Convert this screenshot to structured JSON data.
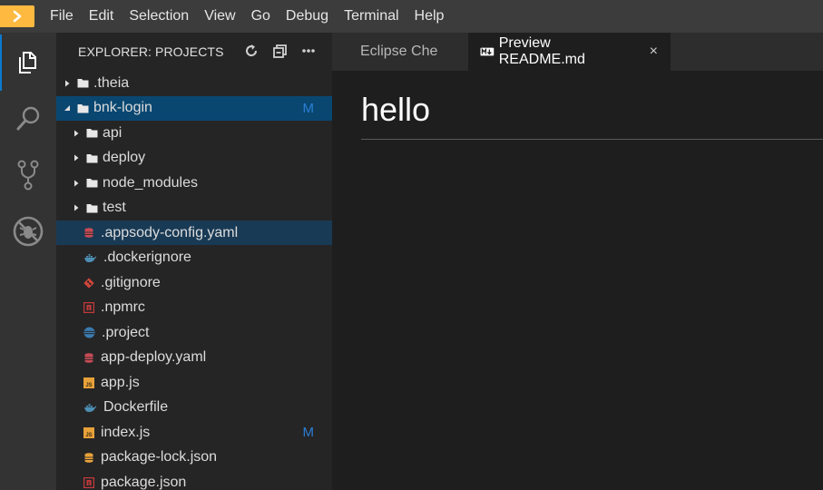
{
  "menubar": {
    "items": [
      "File",
      "Edit",
      "Selection",
      "View",
      "Go",
      "Debug",
      "Terminal",
      "Help"
    ]
  },
  "activitybar": {
    "icons": [
      "files-icon",
      "search-icon",
      "source-control-icon",
      "debug-icon"
    ]
  },
  "explorer": {
    "title": "EXPLORER: PROJECTS",
    "head_icons": [
      "refresh-icon",
      "collapse-all-icon",
      "more-icon"
    ],
    "rows": [
      {
        "label": ".theia",
        "kind": "folder",
        "twist": "collapsed",
        "indent": 0,
        "badge": ""
      },
      {
        "label": "bnk-login",
        "kind": "folder",
        "twist": "expanded",
        "indent": 0,
        "badge": "M",
        "state": "selected"
      },
      {
        "label": "api",
        "kind": "folder",
        "twist": "collapsed",
        "indent": 1,
        "badge": ""
      },
      {
        "label": "deploy",
        "kind": "folder",
        "twist": "collapsed",
        "indent": 1,
        "badge": ""
      },
      {
        "label": "node_modules",
        "kind": "folder",
        "twist": "collapsed",
        "indent": 1,
        "badge": ""
      },
      {
        "label": "test",
        "kind": "folder",
        "twist": "collapsed",
        "indent": 1,
        "badge": ""
      },
      {
        "label": ".appsody-config.yaml",
        "kind": "yaml",
        "indent": 1,
        "badge": "",
        "state": "focused"
      },
      {
        "label": ".dockerignore",
        "kind": "docker",
        "indent": 1,
        "badge": ""
      },
      {
        "label": ".gitignore",
        "kind": "git",
        "indent": 1,
        "badge": ""
      },
      {
        "label": ".npmrc",
        "kind": "npm",
        "indent": 1,
        "badge": ""
      },
      {
        "label": ".project",
        "kind": "eclipse",
        "indent": 1,
        "badge": ""
      },
      {
        "label": "app-deploy.yaml",
        "kind": "yaml",
        "indent": 1,
        "badge": ""
      },
      {
        "label": "app.js",
        "kind": "js",
        "indent": 1,
        "badge": ""
      },
      {
        "label": "Dockerfile",
        "kind": "docker",
        "indent": 1,
        "badge": ""
      },
      {
        "label": "index.js",
        "kind": "js",
        "indent": 1,
        "badge": "M"
      },
      {
        "label": "package-lock.json",
        "kind": "json-lock",
        "indent": 1,
        "badge": ""
      },
      {
        "label": "package.json",
        "kind": "npm",
        "indent": 1,
        "badge": ""
      }
    ]
  },
  "tabs": [
    {
      "label": "Eclipse Che",
      "active": false
    },
    {
      "label": "Preview README.md",
      "active": true,
      "icon": "markdown-icon",
      "close": "×"
    }
  ],
  "preview": {
    "heading": "hello"
  },
  "colors": {
    "accent": "#0b7ad1",
    "logo": "#fdb940",
    "modified_badge": "#2a7ed3",
    "selected_row": "#094771"
  }
}
